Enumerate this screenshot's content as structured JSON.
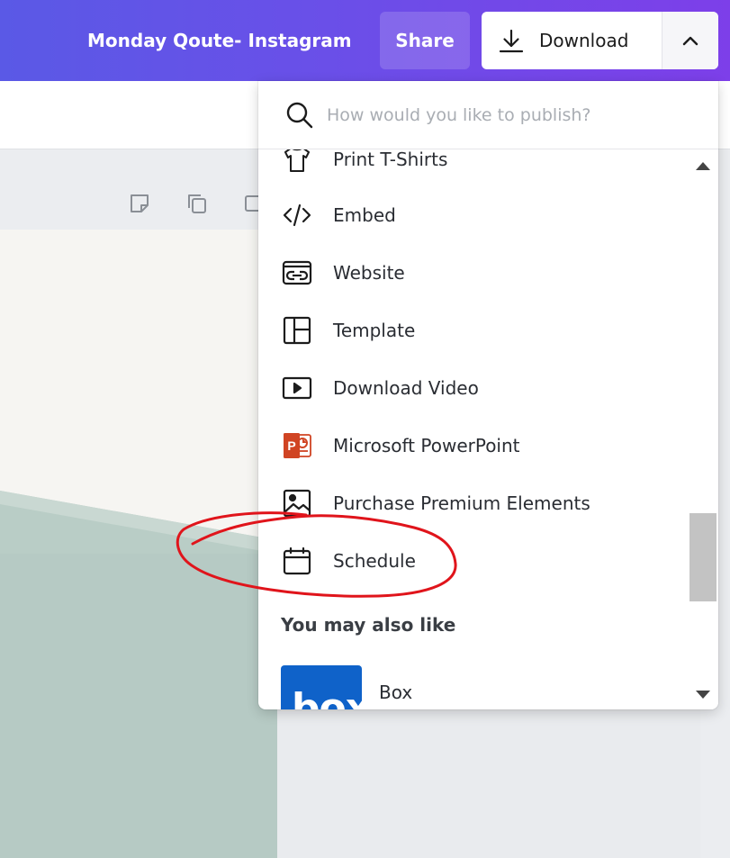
{
  "header": {
    "doc_title": "Monday Qoute- Instagram",
    "share_label": "Share",
    "download_label": "Download",
    "gradient_start": "#5a59e6",
    "gradient_end": "#7d3fe9"
  },
  "publish_menu": {
    "search_placeholder": "How would you like to publish?",
    "items": [
      {
        "label": "Print T-Shirts",
        "icon": "tshirt-icon"
      },
      {
        "label": "Embed",
        "icon": "code-icon"
      },
      {
        "label": "Website",
        "icon": "website-icon"
      },
      {
        "label": "Template",
        "icon": "template-icon"
      },
      {
        "label": "Download Video",
        "icon": "video-icon"
      },
      {
        "label": "Microsoft PowerPoint",
        "icon": "powerpoint-icon"
      },
      {
        "label": "Purchase Premium Elements",
        "icon": "image-icon"
      },
      {
        "label": "Schedule",
        "icon": "calendar-icon"
      }
    ],
    "suggest_title": "You may also like",
    "suggestions": [
      {
        "label": "Box",
        "logo_text": "box",
        "color": "#0f62c9"
      }
    ]
  },
  "annotation_color": "#e0141b",
  "powerpoint_color": "#d04423"
}
